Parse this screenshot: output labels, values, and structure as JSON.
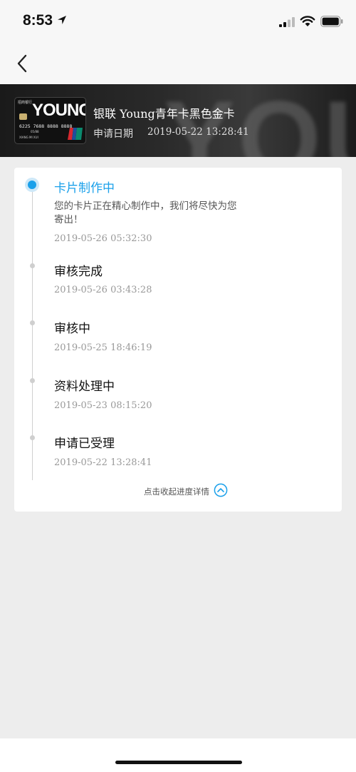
{
  "status_bar": {
    "time": "8:53"
  },
  "card": {
    "bank_name": "招商银行",
    "brand_word": "YOUNG",
    "background_word": "YOUNG",
    "number": "6225 7688 8888 8888",
    "expiry": "05/88",
    "holder": "XIANG MI XUI",
    "title": "银联 Young青年卡黑色金卡",
    "apply_label": "申请日期",
    "apply_date": "2019-05-22 13:28:41"
  },
  "timeline": [
    {
      "title": "卡片制作中",
      "desc": "您的卡片正在精心制作中，我们将尽快为您寄出！",
      "time": "2019-05-26 05:32:30",
      "active": true
    },
    {
      "title": "审核完成",
      "time": "2019-05-26 03:43:28"
    },
    {
      "title": "审核中",
      "time": "2019-05-25 18:46:19"
    },
    {
      "title": "资料处理中",
      "time": "2019-05-23 08:15:20"
    },
    {
      "title": "申请已受理",
      "time": "2019-05-22 13:28:41"
    }
  ],
  "collapse_label": "点击收起进度详情",
  "colors": {
    "accent": "#1aa0ea",
    "header_bg": "#1f1f1f",
    "page_bg": "#ededed"
  },
  "icons": [
    "location-arrow-icon",
    "signal-icon",
    "wifi-icon",
    "battery-icon",
    "back-chevron-icon",
    "unionpay-icon",
    "chevron-up-circle-icon"
  ]
}
